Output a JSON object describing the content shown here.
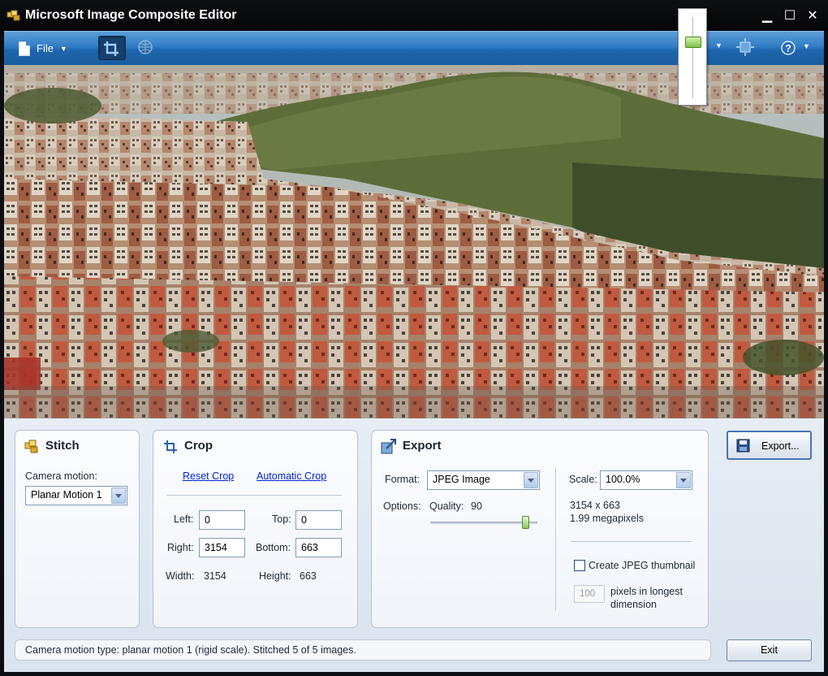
{
  "window": {
    "title": "Microsoft Image Composite Editor",
    "minimize": "▁",
    "maximize": "☐",
    "close": "✕"
  },
  "toolbar": {
    "file_label": "File",
    "file_arrow": "▼",
    "view_arrow": "▼",
    "help_arrow": "▼"
  },
  "stitch": {
    "title": "Stitch",
    "camera_motion_label": "Camera motion:",
    "camera_motion_value": "Planar Motion 1"
  },
  "crop": {
    "title": "Crop",
    "reset_link": "Reset Crop",
    "auto_link": "Automatic Crop",
    "left_label": "Left:",
    "left_value": "0",
    "top_label": "Top:",
    "top_value": "0",
    "right_label": "Right:",
    "right_value": "3154",
    "bottom_label": "Bottom:",
    "bottom_value": "663",
    "width_label": "Width:",
    "width_value": "3154",
    "height_label": "Height:",
    "height_value": "663"
  },
  "export": {
    "title": "Export",
    "format_label": "Format:",
    "format_value": "JPEG Image",
    "options_label": "Options:",
    "quality_label": "Quality:",
    "quality_value": "90",
    "scale_label": "Scale:",
    "scale_value": "100.0%",
    "dimensions": "3154 x 663",
    "megapixels": "1.99 megapixels",
    "thumbnail_label": "Create JPEG thumbnail",
    "thumbnail_size": "100",
    "pixels_label_1": "pixels in longest",
    "pixels_label_2": "dimension",
    "export_button": "Export...",
    "exit_button": "Exit"
  },
  "status": {
    "text": "Camera motion type: planar motion 1 (rigid scale). Stitched 5 of 5 images."
  },
  "colors": {
    "toolbar_blue": "#2f7cc4",
    "titlebar": "#0d0f14",
    "panel_bg": "#f1f5fa",
    "link": "#0026d6"
  }
}
